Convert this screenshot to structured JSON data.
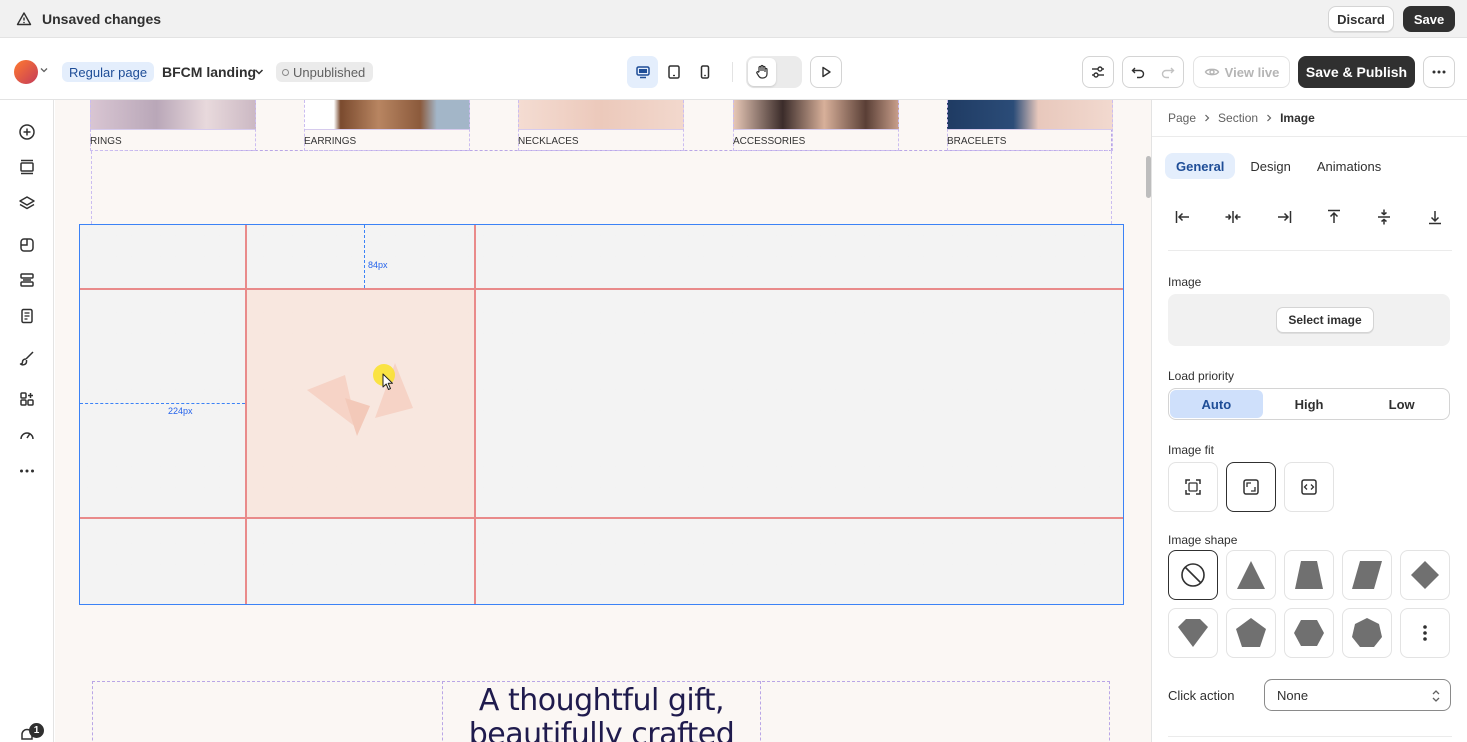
{
  "unsaved_bar": {
    "title": "Unsaved changes",
    "discard_label": "Discard",
    "save_label": "Save"
  },
  "toolbar": {
    "page_type": "Regular page",
    "page_name": "BFCM landing",
    "status": "Unpublished",
    "view_live_label": "View live",
    "save_publish_label": "Save & Publish"
  },
  "rail": {
    "notification_count": "1"
  },
  "canvas": {
    "categories": [
      {
        "label": "RINGS"
      },
      {
        "label": "EARRINGS"
      },
      {
        "label": "NECKLACES"
      },
      {
        "label": "ACCESSORIES"
      },
      {
        "label": "BRACELETS"
      }
    ],
    "dim_vertical": "84px",
    "dim_horizontal": "224px",
    "headline_line1": "A thoughtful gift,",
    "headline_line2": "beautifully crafted"
  },
  "panel": {
    "breadcrumb": [
      "Page",
      "Section",
      "Image"
    ],
    "tabs": [
      "General",
      "Design",
      "Animations"
    ],
    "image_label": "Image",
    "select_image_label": "Select image",
    "load_priority_label": "Load priority",
    "load_priority_options": [
      "Auto",
      "High",
      "Low"
    ],
    "load_priority_selected": "Auto",
    "image_fit_label": "Image fit",
    "image_shape_label": "Image shape",
    "click_action_label": "Click action",
    "click_action_value": "None"
  },
  "colors": {
    "accent": "#3b82f6",
    "guide_line": "#e98a8a",
    "dark_button": "#303030",
    "active_tab_bg": "#e4eefc",
    "headline": "#1f1b4d"
  }
}
